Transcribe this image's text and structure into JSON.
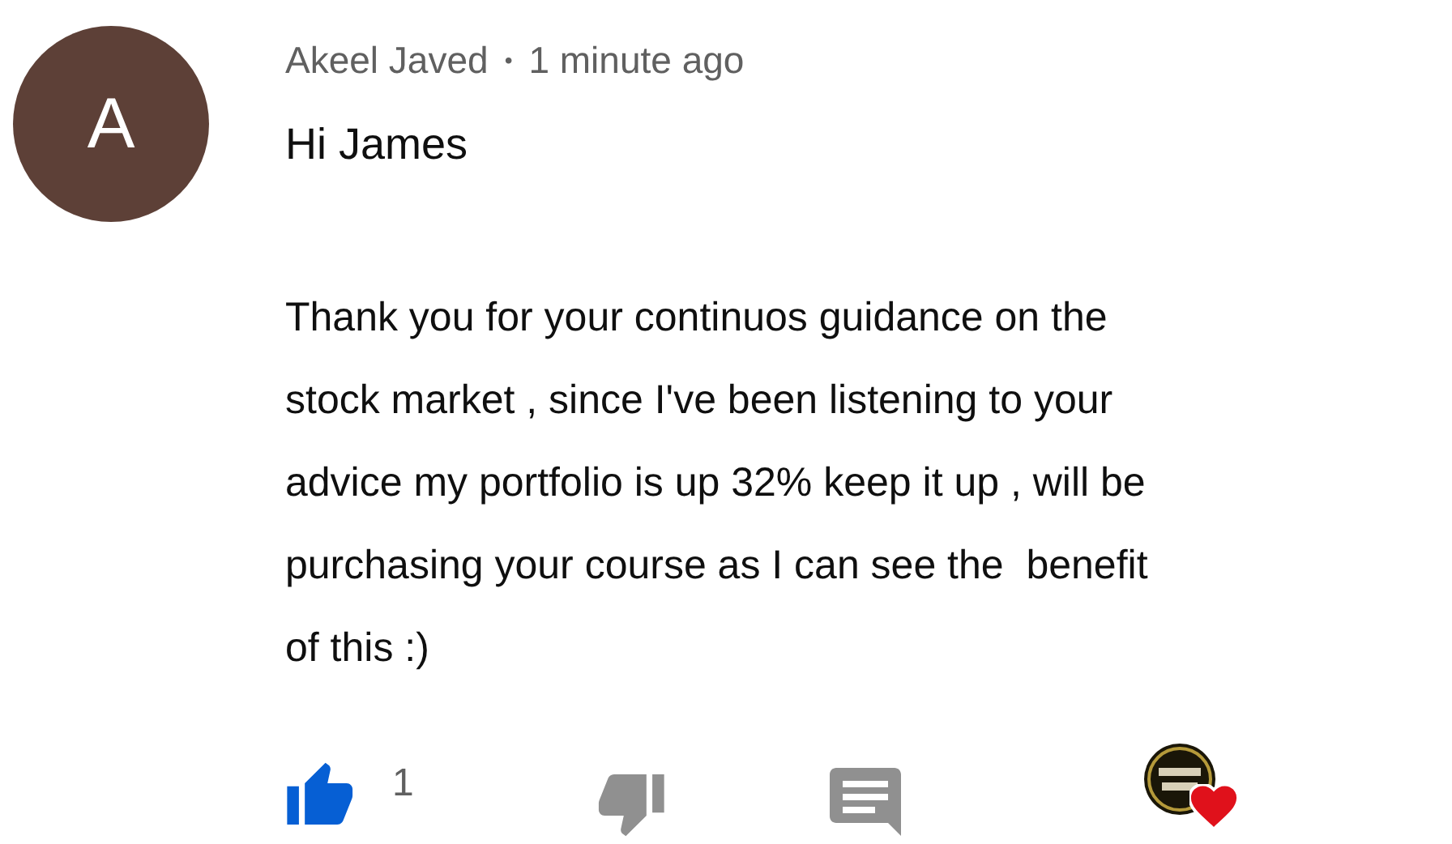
{
  "comment": {
    "avatar_letter": "A",
    "author": "Akeel Javed",
    "separator": "•",
    "time": "1 minute ago",
    "greeting": "Hi James",
    "body_lines": [
      "Thank you for your continuos guidance on the",
      "stock market , since I've been listening to your",
      "advice my portfolio is up 32% keep it up , will be",
      "purchasing your course as I can see the  benefit",
      "of this :)"
    ]
  },
  "actions": {
    "liked": true,
    "like_count": "1",
    "creator_hearted": true
  }
}
